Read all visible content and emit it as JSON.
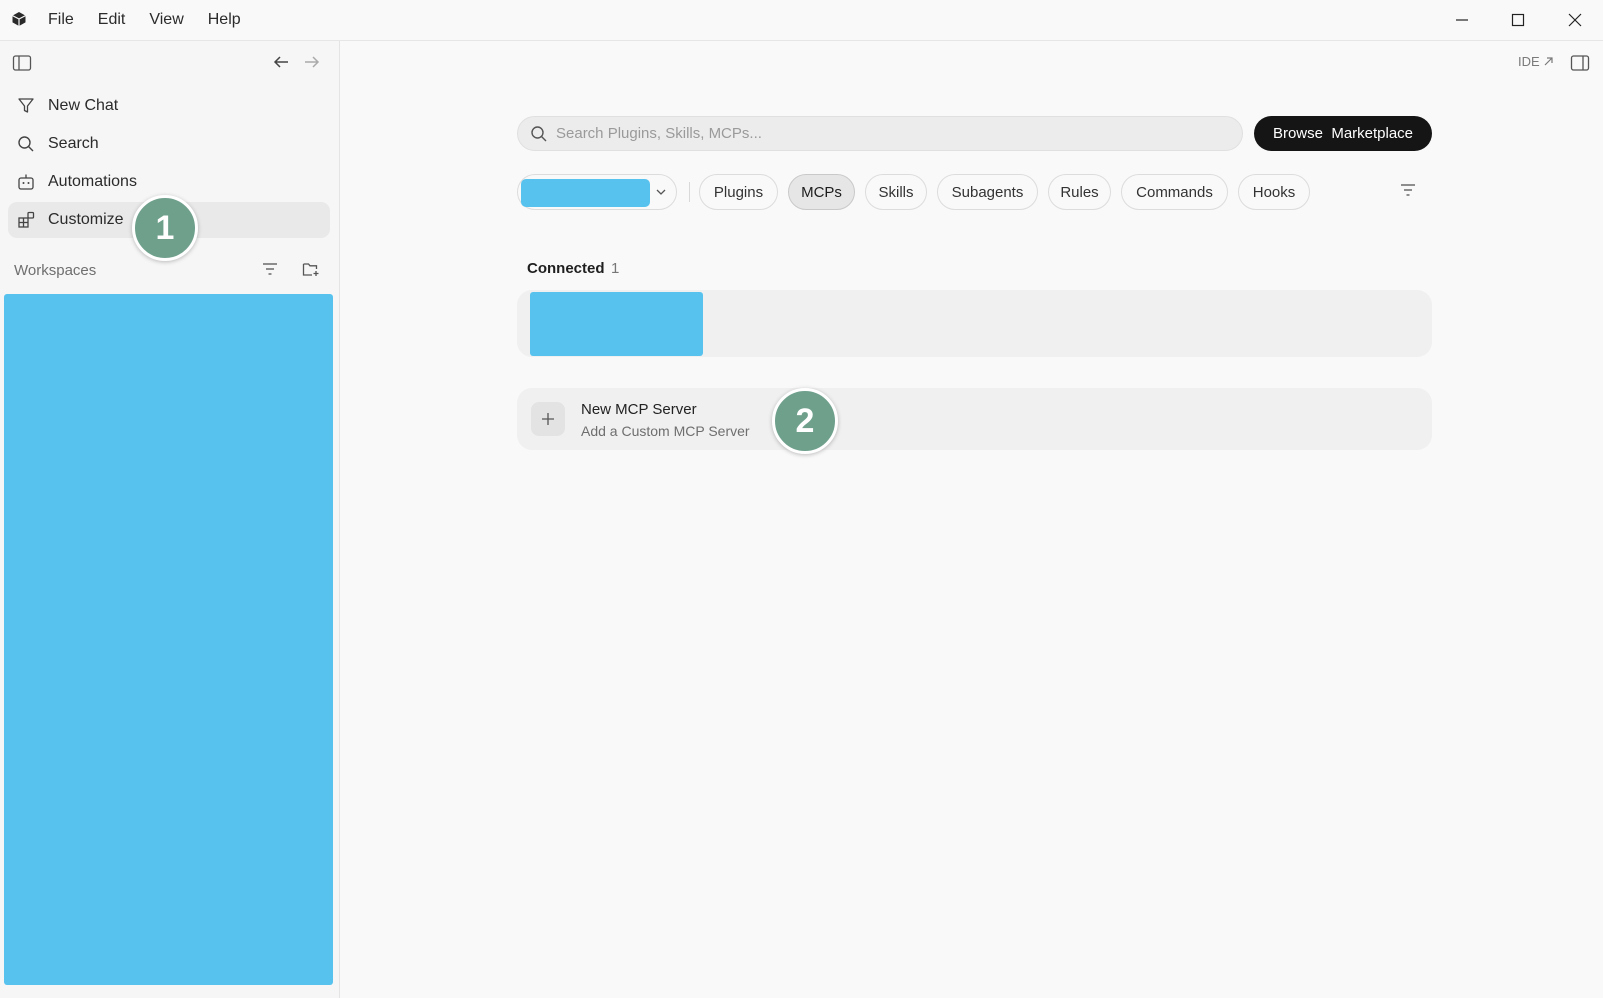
{
  "menu": [
    "File",
    "Edit",
    "View",
    "Help"
  ],
  "sidebar": {
    "items": [
      {
        "label": "New Chat",
        "icon": "new-chat-icon"
      },
      {
        "label": "Search",
        "icon": "search-icon"
      },
      {
        "label": "Automations",
        "icon": "automations-icon"
      },
      {
        "label": "Customize",
        "icon": "customize-icon",
        "active": true
      }
    ],
    "workspaces_title": "Workspaces"
  },
  "header": {
    "ide_label": "IDE"
  },
  "search": {
    "placeholder": "Search Plugins, Skills, MCPs..."
  },
  "browse_button": "Browse  Marketplace",
  "tabs": [
    {
      "label": "Plugins",
      "active": false
    },
    {
      "label": "MCPs",
      "active": true
    },
    {
      "label": "Skills",
      "active": false
    },
    {
      "label": "Subagents",
      "active": false
    },
    {
      "label": "Rules",
      "active": false
    },
    {
      "label": "Commands",
      "active": false
    },
    {
      "label": "Hooks",
      "active": false
    }
  ],
  "connected": {
    "label": "Connected",
    "count": "1"
  },
  "new_server": {
    "title": "New MCP Server",
    "subtitle": "Add a Custom MCP Server"
  },
  "badges": [
    "1",
    "2"
  ],
  "colors": {
    "redaction": "#58c2ee",
    "badge": "#6fa08c",
    "primary_button": "#151515"
  }
}
